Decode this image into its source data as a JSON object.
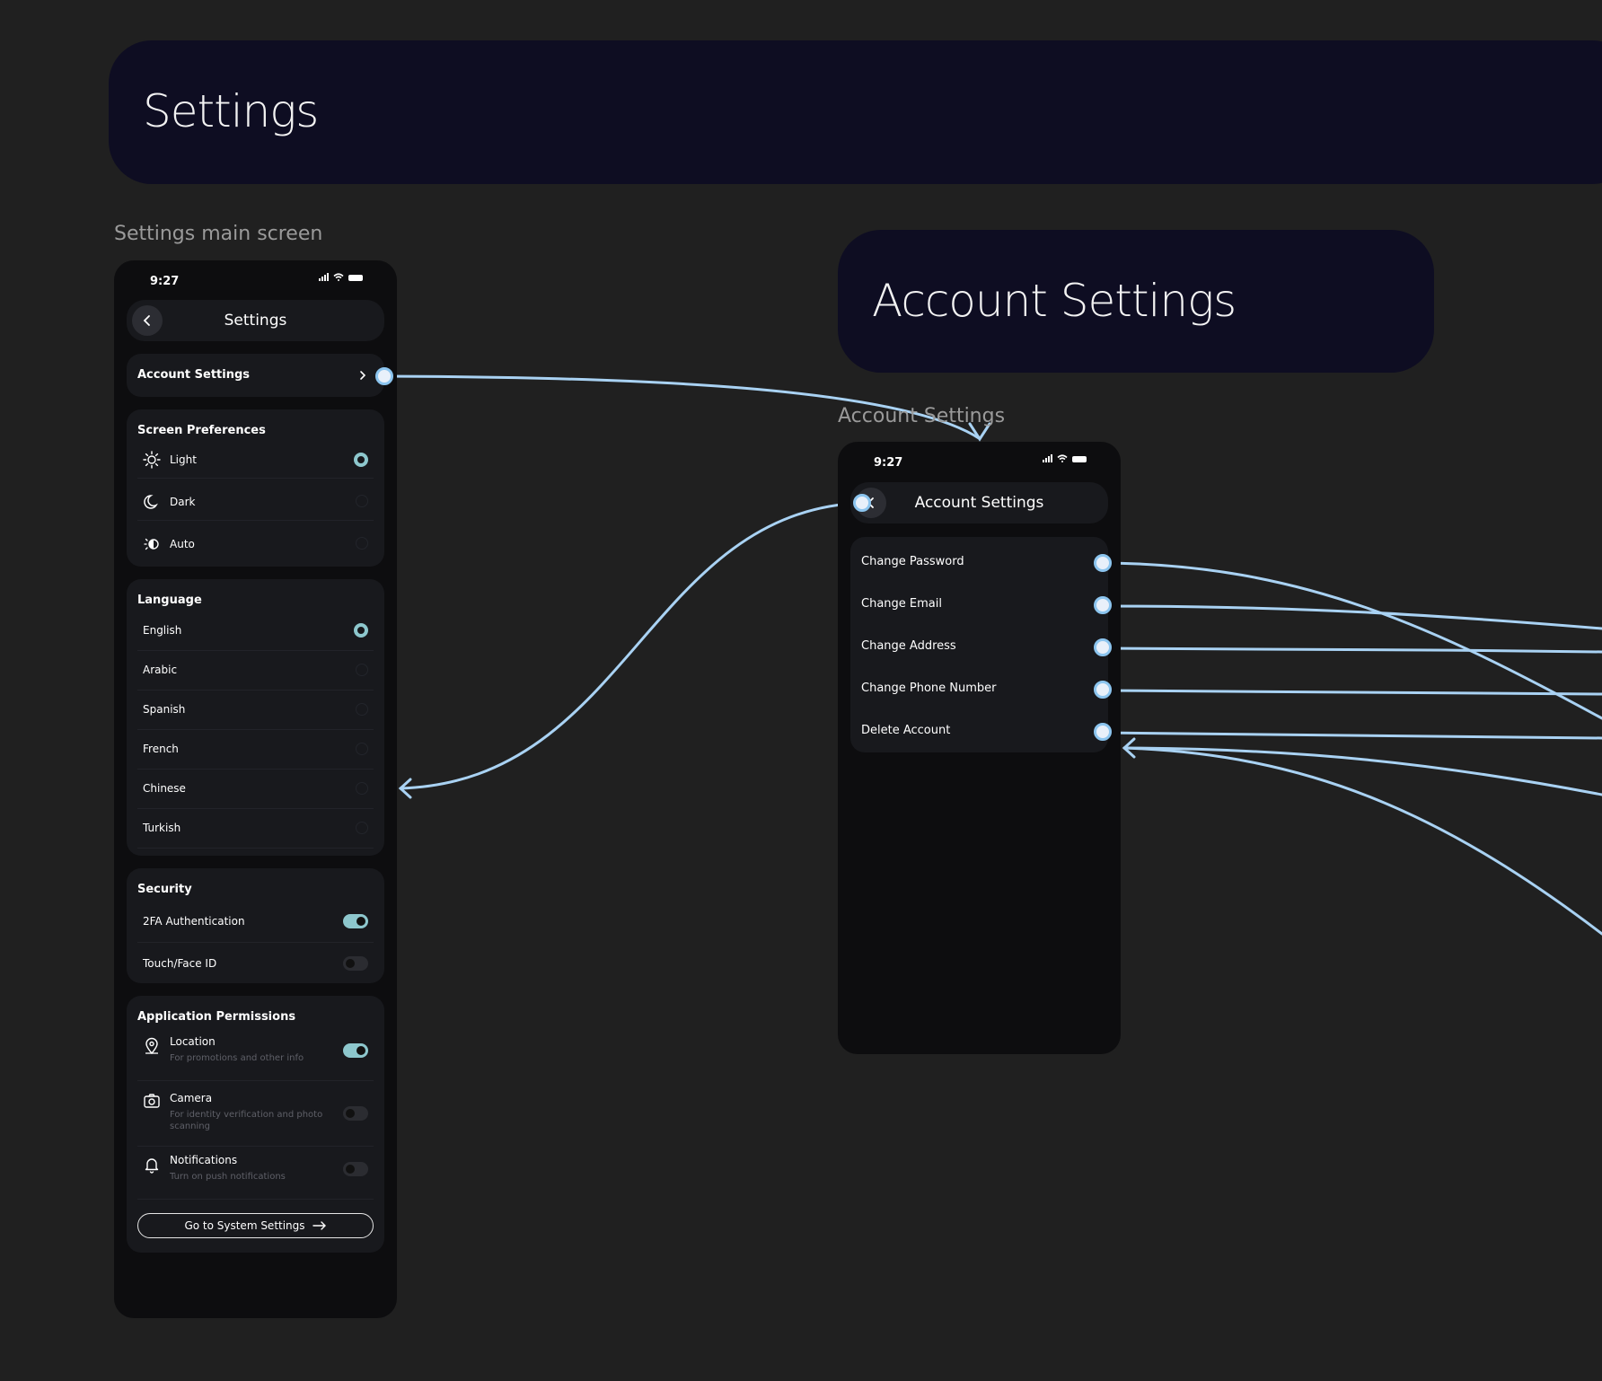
{
  "banner_main": {
    "title": "Settings"
  },
  "banner_account": {
    "title": "Account Settings"
  },
  "settings_frame": {
    "label": "Settings main screen",
    "status_time": "9:27",
    "header_title": "Settings",
    "account_settings_label": "Account Settings",
    "screen_prefs": {
      "title": "Screen Preferences",
      "options": [
        {
          "label": "Light",
          "icon": "sun-icon",
          "selected": true
        },
        {
          "label": "Dark",
          "icon": "moon-icon",
          "selected": false
        },
        {
          "label": "Auto",
          "icon": "auto-icon",
          "selected": false
        }
      ]
    },
    "language": {
      "title": "Language",
      "options": [
        {
          "label": "English",
          "selected": true
        },
        {
          "label": "Arabic",
          "selected": false
        },
        {
          "label": "Spanish",
          "selected": false
        },
        {
          "label": "French",
          "selected": false
        },
        {
          "label": "Chinese",
          "selected": false
        },
        {
          "label": "Turkish",
          "selected": false
        }
      ]
    },
    "security": {
      "title": "Security",
      "items": [
        {
          "label": "2FA Authentication",
          "on": true
        },
        {
          "label": "Touch/Face ID",
          "on": false
        }
      ]
    },
    "permissions": {
      "title": "Application Permissions",
      "items": [
        {
          "label": "Location",
          "sub": "For promotions and other info",
          "icon": "location-pin-icon",
          "on": true
        },
        {
          "label": "Camera",
          "sub": "For identity verification and photo scanning",
          "icon": "camera-icon",
          "on": false
        },
        {
          "label": "Notifications",
          "sub": "Turn on push notifications",
          "icon": "bell-icon",
          "on": false
        }
      ],
      "system_button": "Go to System Settings"
    }
  },
  "account_frame": {
    "label": "Account Settings",
    "status_time": "9:27",
    "header_title": "Account Settings",
    "items": [
      "Change Password",
      "Change Email",
      "Change Address",
      "Change Phone Number",
      "Delete Account"
    ]
  },
  "colors": {
    "accent": "#8dc7cd",
    "connector": "#8cc5ef",
    "banner": "#0e0d22",
    "canvas": "#202020"
  }
}
